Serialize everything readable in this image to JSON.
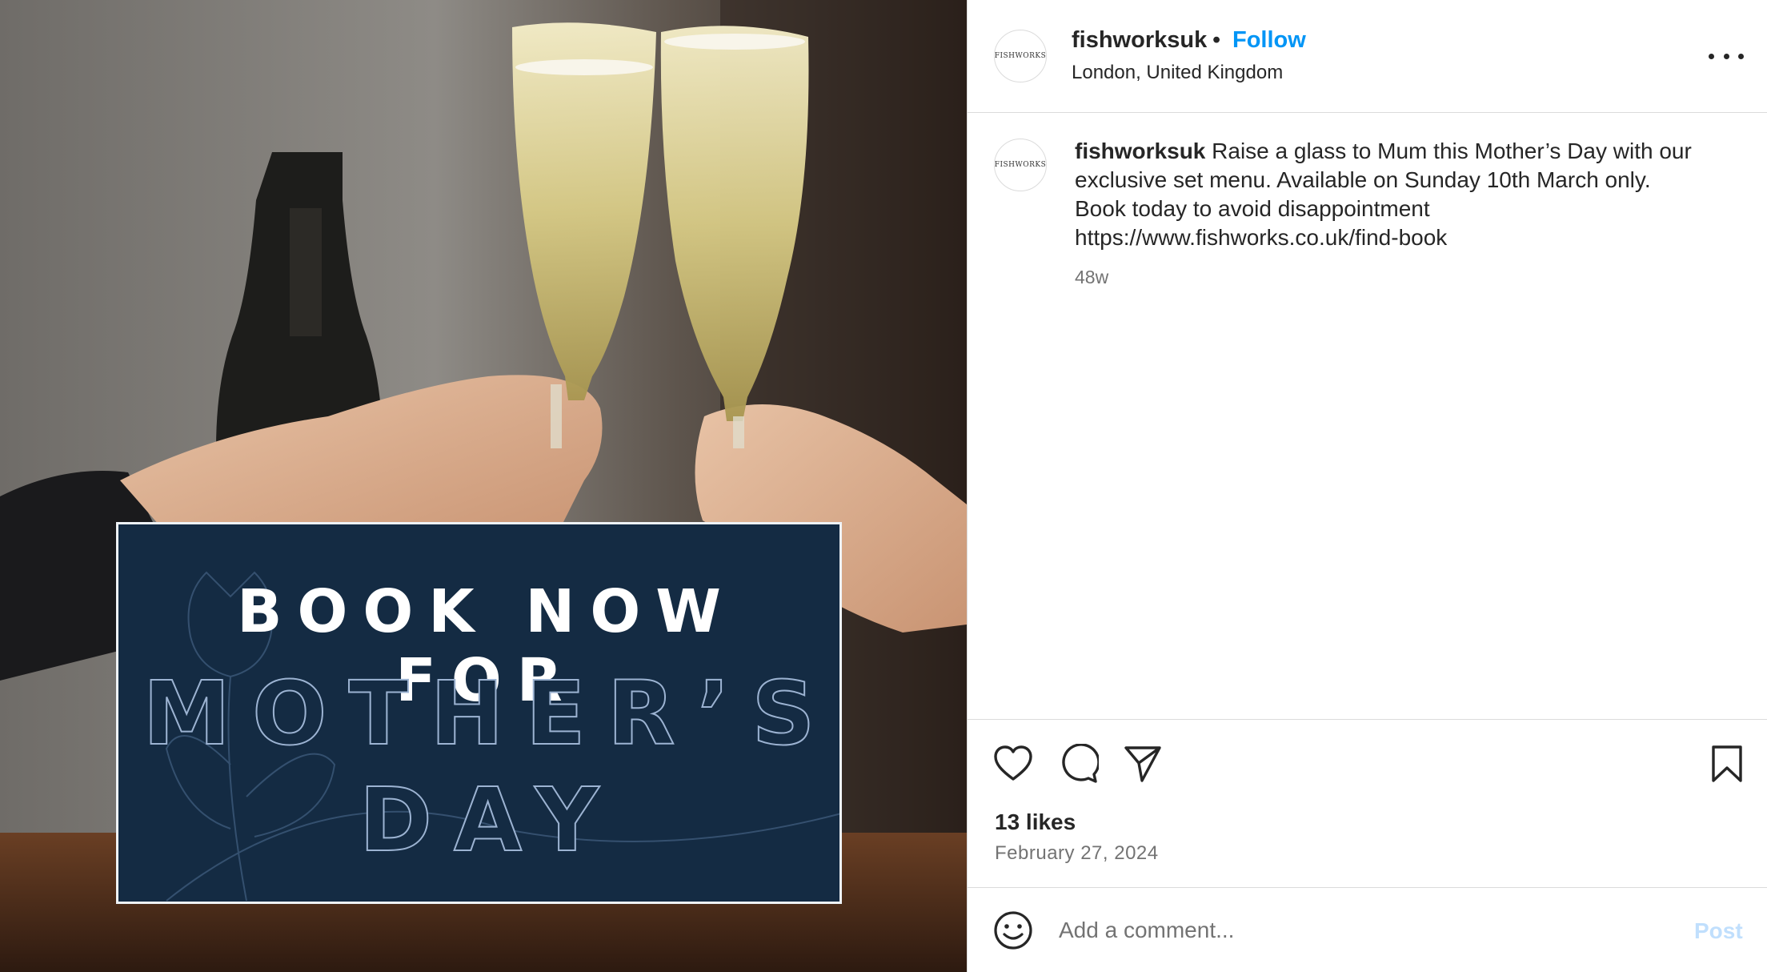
{
  "post": {
    "image": {
      "banner_line1": "BOOK NOW FOR",
      "banner_line2": "MOTHER’S",
      "banner_line3": "DAY",
      "banner_color": "#142b43"
    },
    "header": {
      "avatar_text": "FISHWORKS",
      "username": "fishworksuk",
      "separator": "•",
      "follow_label": "Follow",
      "location": "London, United Kingdom",
      "more_icon": "more-horizontal-icon"
    },
    "caption": {
      "username": "fishworksuk",
      "text": " Raise a glass to Mum this Mother’s Day with our exclusive set menu. Available on Sunday 10th March only.",
      "line2": "Book today to avoid disappointment",
      "link": "https://www.fishworks.co.uk/find-book",
      "time": "48w"
    },
    "actions": {
      "icons": [
        "heart-icon",
        "comment-icon",
        "share-icon",
        "bookmark-icon"
      ],
      "likes": "13 likes",
      "date": "February 27, 2024"
    },
    "comment": {
      "emoji_icon": "emoji-icon",
      "placeholder": "Add a comment...",
      "post_label": "Post"
    },
    "colors": {
      "accent": "#0095f6",
      "post_disabled": "#c0dffd",
      "text": "#262626",
      "muted": "#737373",
      "border": "#dbdbdb"
    }
  }
}
